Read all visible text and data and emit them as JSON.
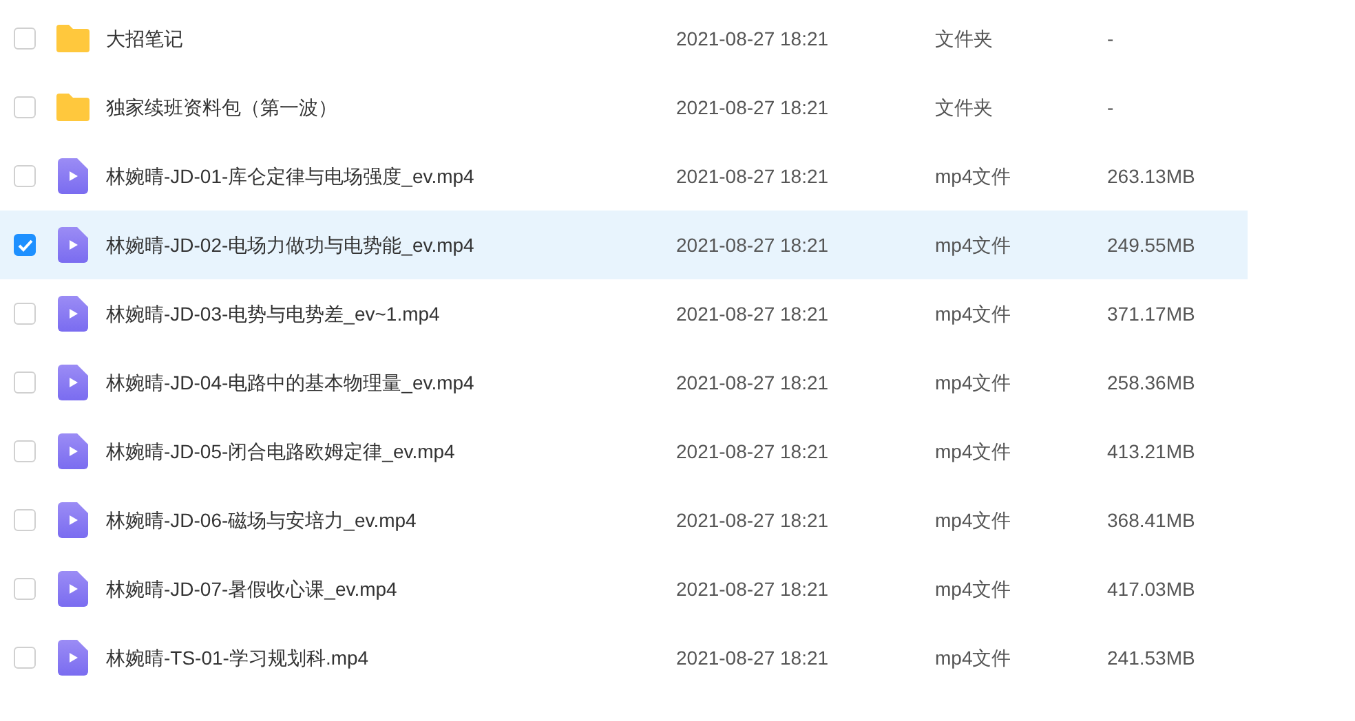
{
  "files": [
    {
      "kind": "folder",
      "name": "大招笔记",
      "date": "2021-08-27 18:21",
      "type": "文件夹",
      "size": "-",
      "selected": false
    },
    {
      "kind": "folder",
      "name": "独家续班资料包（第一波）",
      "date": "2021-08-27 18:21",
      "type": "文件夹",
      "size": "-",
      "selected": false
    },
    {
      "kind": "video",
      "name": "林婉晴-JD-01-库仑定律与电场强度_ev.mp4",
      "date": "2021-08-27 18:21",
      "type": "mp4文件",
      "size": "263.13MB",
      "selected": false
    },
    {
      "kind": "video",
      "name": "林婉晴-JD-02-电场力做功与电势能_ev.mp4",
      "date": "2021-08-27 18:21",
      "type": "mp4文件",
      "size": "249.55MB",
      "selected": true
    },
    {
      "kind": "video",
      "name": "林婉晴-JD-03-电势与电势差_ev~1.mp4",
      "date": "2021-08-27 18:21",
      "type": "mp4文件",
      "size": "371.17MB",
      "selected": false
    },
    {
      "kind": "video",
      "name": "林婉晴-JD-04-电路中的基本物理量_ev.mp4",
      "date": "2021-08-27 18:21",
      "type": "mp4文件",
      "size": "258.36MB",
      "selected": false
    },
    {
      "kind": "video",
      "name": "林婉晴-JD-05-闭合电路欧姆定律_ev.mp4",
      "date": "2021-08-27 18:21",
      "type": "mp4文件",
      "size": "413.21MB",
      "selected": false
    },
    {
      "kind": "video",
      "name": "林婉晴-JD-06-磁场与安培力_ev.mp4",
      "date": "2021-08-27 18:21",
      "type": "mp4文件",
      "size": "368.41MB",
      "selected": false
    },
    {
      "kind": "video",
      "name": "林婉晴-JD-07-暑假收心课_ev.mp4",
      "date": "2021-08-27 18:21",
      "type": "mp4文件",
      "size": "417.03MB",
      "selected": false
    },
    {
      "kind": "video",
      "name": "林婉晴-TS-01-学习规划科.mp4",
      "date": "2021-08-27 18:21",
      "type": "mp4文件",
      "size": "241.53MB",
      "selected": false
    }
  ]
}
